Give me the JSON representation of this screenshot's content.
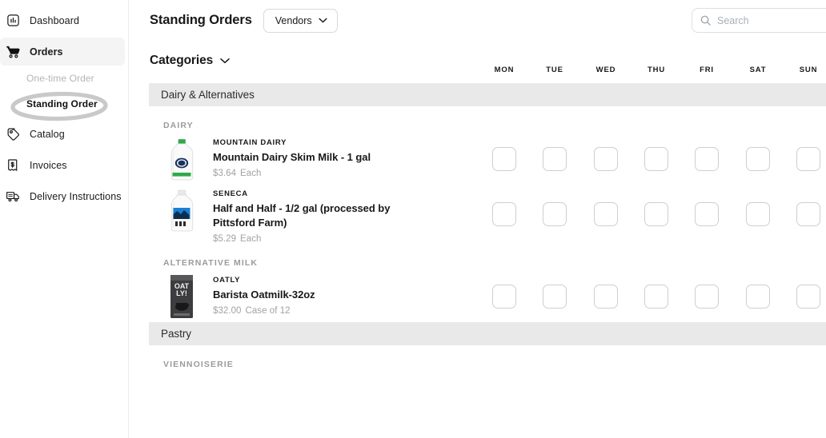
{
  "sidebar": {
    "items": [
      {
        "label": "Dashboard",
        "icon": "dashboard-icon",
        "active": false
      },
      {
        "label": "Orders",
        "icon": "cart-icon",
        "active": true
      },
      {
        "label": "Catalog",
        "icon": "tag-icon",
        "active": false
      },
      {
        "label": "Invoices",
        "icon": "invoice-icon",
        "active": false
      },
      {
        "label": "Delivery Instructions",
        "icon": "truck-icon",
        "active": false
      }
    ],
    "suborders": [
      {
        "label": "One-time Order",
        "current": false
      },
      {
        "label": "Standing Order",
        "current": true
      }
    ]
  },
  "header": {
    "title": "Standing Orders",
    "vendors_label": "Vendors",
    "vendors_icon": "chevron-down-icon"
  },
  "search": {
    "placeholder": "Search",
    "value": "",
    "icon": "search-icon"
  },
  "categories": {
    "label": "Categories",
    "icon": "chevron-down-icon"
  },
  "days": [
    "MON",
    "TUE",
    "WED",
    "THU",
    "FRI",
    "SAT",
    "SUN"
  ],
  "sections": [
    {
      "name": "Dairy & Alternatives",
      "subcategories": [
        {
          "name": "DAIRY",
          "products": [
            {
              "brand": "MOUNTAIN DAIRY",
              "name": "Mountain Dairy Skim Milk - 1 gal",
              "price": "$3.64",
              "unit": "Each",
              "image": "milk-jug-gallon"
            },
            {
              "brand": "SENECA",
              "name": "Half and Half - 1/2 gal (processed by Pittsford Farm)",
              "price": "$5.29",
              "unit": "Each",
              "image": "milk-jug-half-gallon"
            }
          ]
        },
        {
          "name": "ALTERNATIVE MILK",
          "products": [
            {
              "brand": "OATLY",
              "name": "Barista Oatmilk-32oz",
              "price": "$32.00",
              "unit": "Case of 12",
              "image": "oatly-carton"
            }
          ]
        }
      ]
    },
    {
      "name": "Pastry",
      "subcategories": [
        {
          "name": "VIENNOISERIE",
          "products": []
        }
      ]
    }
  ],
  "colors": {
    "band": "#e9e9e9",
    "active_nav": "#f4f4f4",
    "text": "#17181a",
    "muted": "#a2a2a2",
    "box_border": "#cfcfcf",
    "annotation": "#c9c9c9"
  }
}
